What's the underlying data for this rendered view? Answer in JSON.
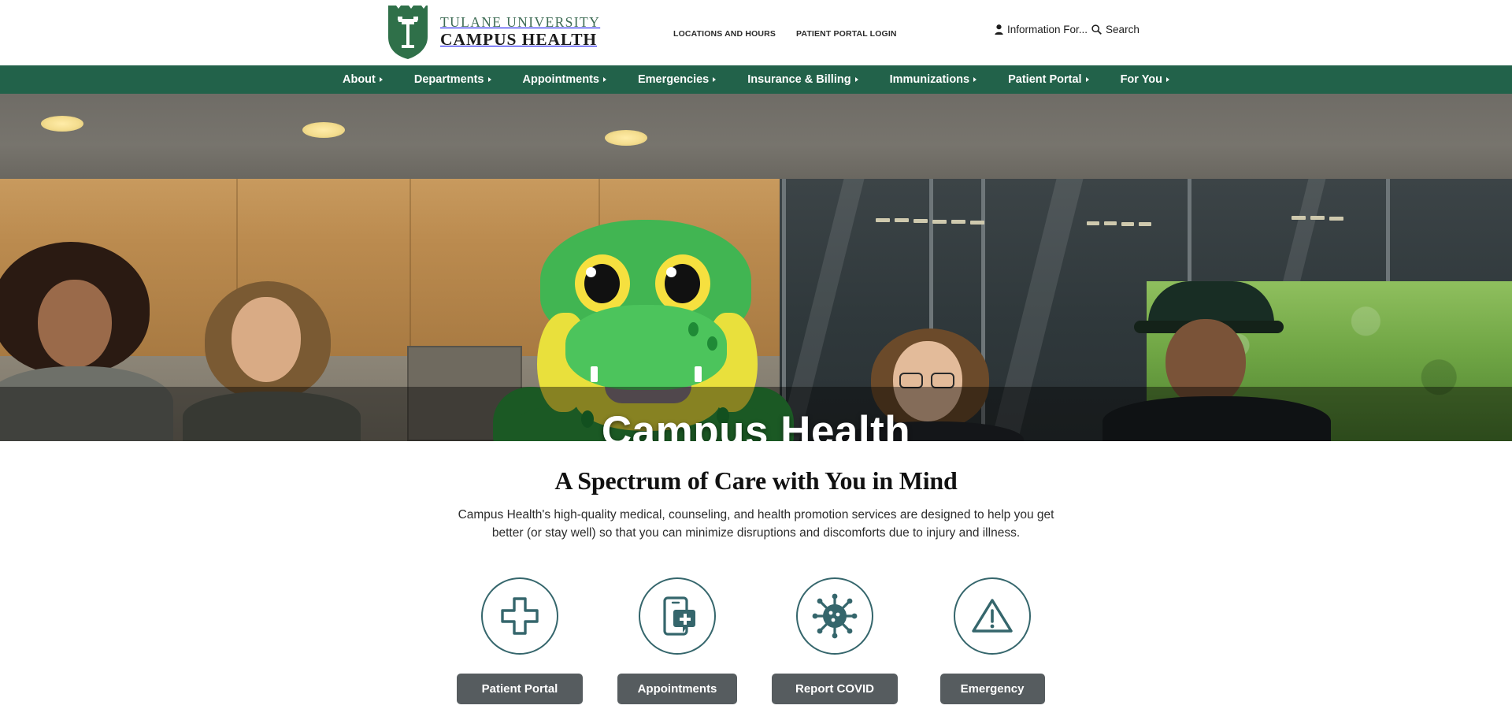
{
  "header": {
    "logo": {
      "shield_icon": "tulane-shield-icon",
      "line1": "TULANE UNIVERSITY",
      "line2": "CAMPUS HEALTH",
      "green": "#3d6b54"
    },
    "utility_links": [
      {
        "label": "LOCATIONS AND HOURS"
      },
      {
        "label": "PATIENT PORTAL LOGIN"
      }
    ],
    "information_for": {
      "label": "Information For...",
      "icon": "person-icon"
    },
    "search": {
      "label": "Search",
      "icon": "search-icon"
    }
  },
  "nav": {
    "background": "#22624A",
    "items": [
      {
        "label": "About",
        "caret": true
      },
      {
        "label": "Departments",
        "caret": true
      },
      {
        "label": "Appointments",
        "caret": true
      },
      {
        "label": "Emergencies",
        "caret": true
      },
      {
        "label": "Insurance & Billing",
        "caret": true
      },
      {
        "label": "Immunizations",
        "caret": true
      },
      {
        "label": "Patient Portal",
        "caret": true
      },
      {
        "label": "For You",
        "caret": true
      }
    ]
  },
  "hero": {
    "title": "Campus Health",
    "image_alt": "Students posing with the Tulane Green Wave mascot inside the Campus Health building"
  },
  "main": {
    "section_title": "A Spectrum of Care with You in Mind",
    "section_subtitle": "Campus Health's high-quality medical, counseling, and health promotion services are designed to help you get better (or stay well) so that you can minimize disruptions and discomforts due to injury and illness.",
    "accent_teal": "#35666C",
    "button_gray": "#565C5F",
    "cards": [
      {
        "icon": "medical-cross-icon",
        "label": "Patient Portal"
      },
      {
        "icon": "mobile-appointment-icon",
        "label": "Appointments"
      },
      {
        "icon": "virus-icon",
        "label": "Report COVID"
      },
      {
        "icon": "warning-triangle-icon",
        "label": "Emergency"
      }
    ]
  }
}
